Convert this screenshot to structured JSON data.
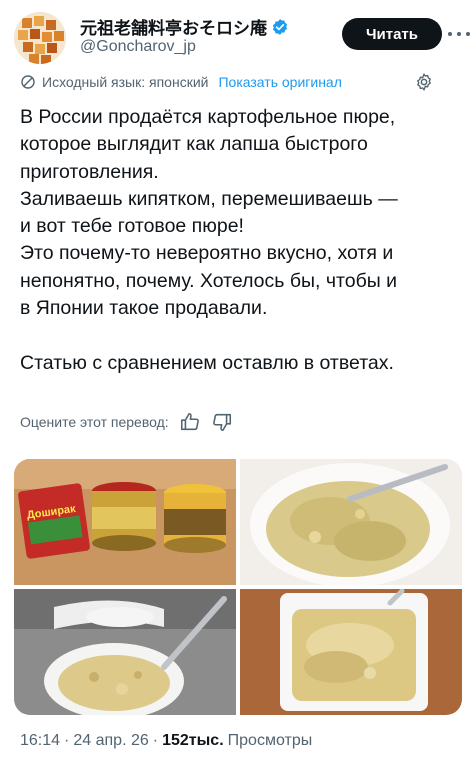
{
  "author": {
    "display_name": "元祖老舗料亭おそロシ庵",
    "handle": "@Goncharov_jp",
    "verified": true
  },
  "follow_button": {
    "label": "Читать"
  },
  "translation": {
    "source_label": "Исходный язык: японский",
    "show_original": "Показать оригинал",
    "rate_label": "Оцените этот перевод:"
  },
  "tweet": {
    "lines": [
      "В России продаётся картофельное пюре,",
      "которое выглядит как лапша быстрого",
      "приготовления.",
      "Заливаешь кипятком, перемешиваешь —",
      "и вот тебе готовое пюре!",
      "Это почему-то невероятно вкусно, хотя и",
      "непонятно, почему. Хотелось бы, чтобы и",
      "в Японии такое продавали.",
      "",
      "Статью с сравнением оставлю в ответах."
    ]
  },
  "photos": {
    "photo1": {
      "brand_label": "Доширак"
    },
    "count": 4
  },
  "meta": {
    "time": "16:14",
    "date": "24 апр. 26",
    "views_count": "152тыс.",
    "views_label": "Просмотры"
  },
  "colors": {
    "accent": "#1d9bf0",
    "text": "#0f1419",
    "muted": "#536471",
    "button_bg": "#0f1419"
  },
  "icons": {
    "verified": "verified-badge-icon",
    "more": "more-dots-icon",
    "translate": "translate-icon",
    "settings": "gear-icon",
    "like": "thumbs-up-icon",
    "dislike": "thumbs-down-icon"
  }
}
